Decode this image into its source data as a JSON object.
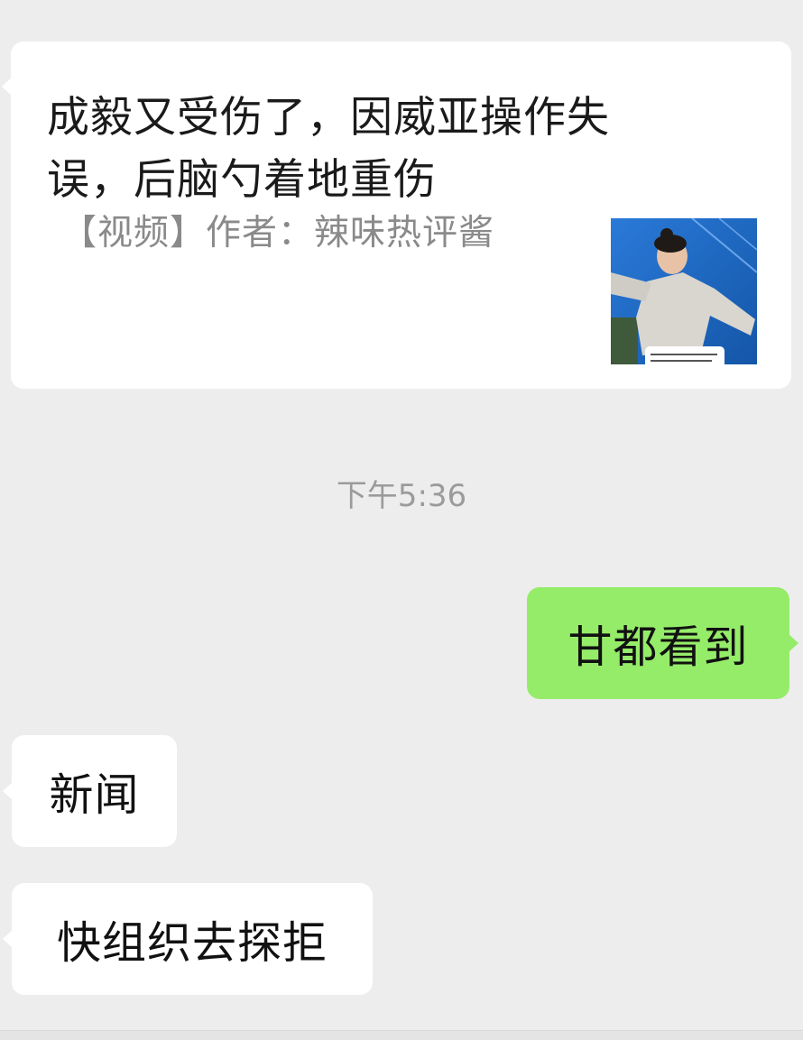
{
  "link_card": {
    "title": "成毅又受伤了，因威亚操作失误，后脑勺着地重伤",
    "description": "【视频】作者：辣味热评酱",
    "thumbnail_caption": "..."
  },
  "timestamp": "下午5:36",
  "messages": [
    {
      "direction": "out",
      "text": "甘都看到"
    },
    {
      "direction": "in",
      "text": "新闻"
    },
    {
      "direction": "in",
      "text": "快组织去探拒"
    }
  ],
  "colors": {
    "background": "#ededed",
    "incoming_bubble": "#ffffff",
    "outgoing_bubble": "#95ec69",
    "timestamp": "#9b9b9b",
    "card_title": "#1a1a1a",
    "card_description": "#8a8a8a"
  }
}
